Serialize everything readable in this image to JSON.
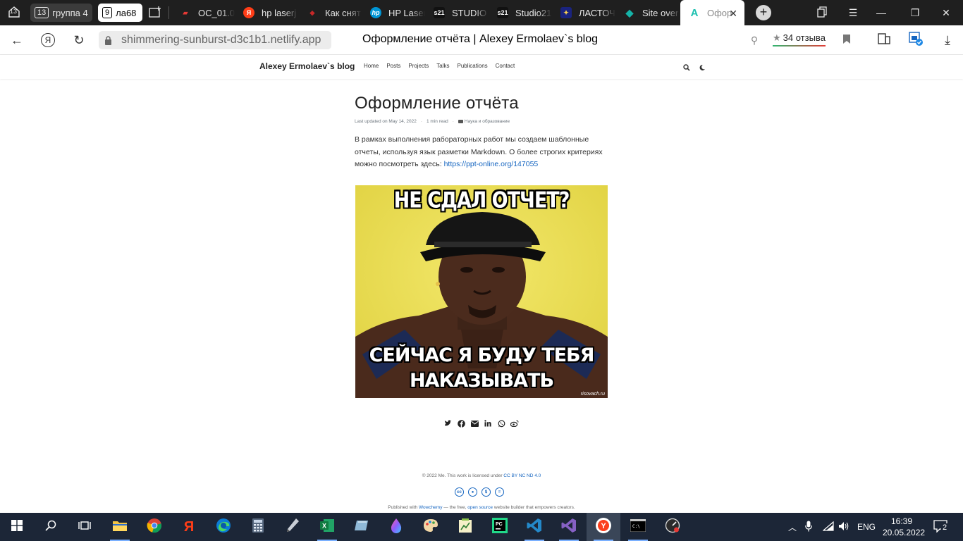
{
  "browser": {
    "tab_groups": [
      {
        "count": "13",
        "name": ""
      },
      {
        "count": "13",
        "name": "группа 4"
      },
      {
        "count": "9",
        "name": "ла68"
      }
    ],
    "tabs": [
      {
        "title": "ОС_01.0",
        "favicon": "laptop-red-icon",
        "color": "#e53935"
      },
      {
        "title": "hp laserj",
        "favicon": "yandex-icon",
        "color": "#ff3d17"
      },
      {
        "title": "Как снят",
        "favicon": "eraser-icon",
        "color": "#c62828"
      },
      {
        "title": "HP Laser",
        "favicon": "hp-icon",
        "color": "#0096d6"
      },
      {
        "title": "STUDIO",
        "favicon": "s21-icon",
        "color": "#111111"
      },
      {
        "title": "Studio21",
        "favicon": "s21-icon",
        "color": "#111111"
      },
      {
        "title": "ЛАСТОЧ",
        "favicon": "sparkle-icon",
        "color": "#3949ab"
      },
      {
        "title": "Site over",
        "favicon": "netlify-diamond-icon",
        "color": "#15b3a8"
      },
      {
        "title": "Офор",
        "favicon": "wowchemy-icon",
        "color": "#1ec0b0"
      }
    ],
    "url": "shimmering-sunburst-d3c1b1.netlify.app",
    "page_title": "Оформление отчёта | Alexey Ermolaev`s blog",
    "reviews_label": "34 отзыва"
  },
  "site": {
    "brand": "Alexey Ermolaev`s blog",
    "menu": [
      "Home",
      "Posts",
      "Projects",
      "Talks",
      "Publications",
      "Contact"
    ]
  },
  "article": {
    "title": "Оформление отчёта",
    "meta_updated": "Last updated on May 14, 2022",
    "meta_read": "1 min read",
    "meta_category": "Наука и образование",
    "body_text": "В рамках выполнения рабораторных работ мы создаем шаблонные отчеты, используя язык разметки Markdown. О более строгих критериях можно посмотреть здесь: ",
    "body_link": "https://ppt-online.org/147055",
    "meme_top": "НЕ СДАЛ ОТЧЕТ?",
    "meme_bottom_1": "СЕЙЧАС Я БУДУ ТЕБЯ",
    "meme_bottom_2": "НАКАЗЫВАТЬ",
    "meme_watermark": "risovach.ru"
  },
  "footer": {
    "license_prefix": "© 2022 Me. This work is licensed under ",
    "license_link": "CC BY NC ND 4.0",
    "published_prefix": "Published with ",
    "published_link1": "Wowchemy",
    "published_mid": " — the free, ",
    "published_link2": "open source",
    "published_suffix": " website builder that empowers creators."
  },
  "taskbar": {
    "language": "ENG",
    "time": "16:39",
    "date": "20.05.2022",
    "notifications": "2"
  }
}
